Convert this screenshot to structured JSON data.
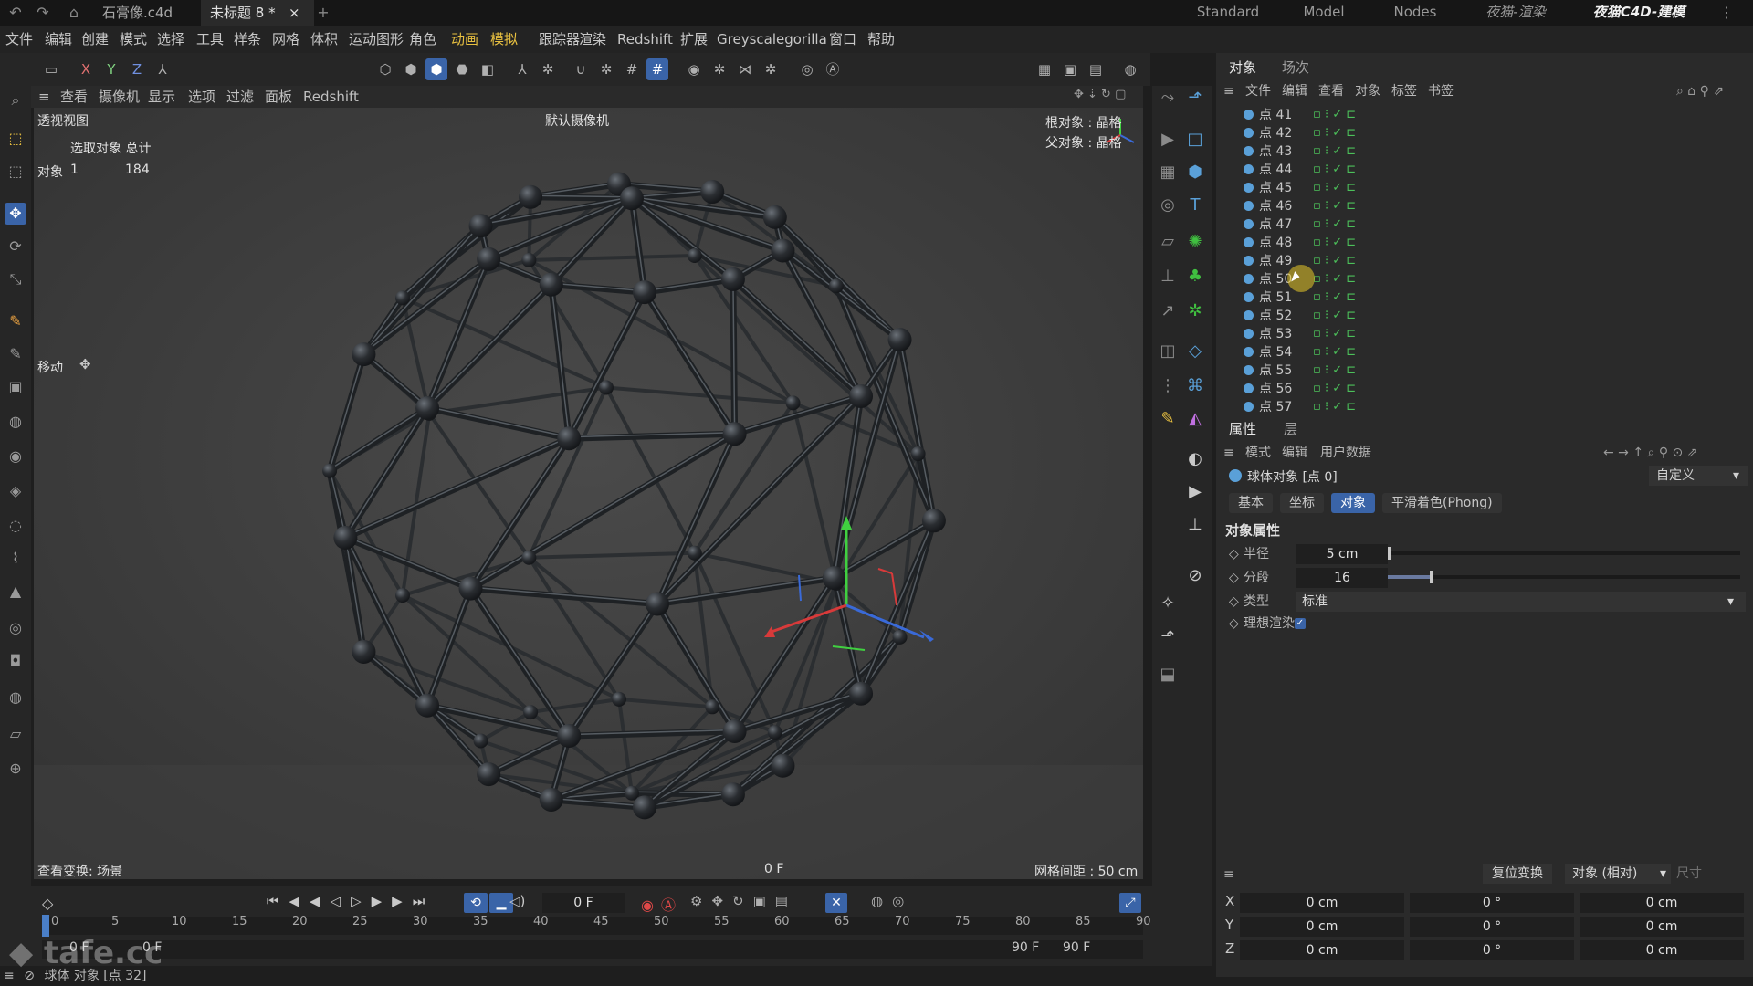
{
  "titlebar": {
    "tabs": [
      {
        "label": "石膏像.c4d",
        "active": false
      },
      {
        "label": "未标题 8 *",
        "active": true
      }
    ],
    "layouts": [
      "Standard",
      "Model",
      "Nodes",
      "夜猫-渲染",
      "夜猫C4D-建模"
    ],
    "active_layout": "夜猫C4D-建模"
  },
  "menubar": {
    "items": [
      "文件",
      "编辑",
      "创建",
      "模式",
      "选择",
      "工具",
      "样条",
      "网格",
      "体积",
      "运动图形",
      "角色",
      "动画",
      "模拟",
      "跟踪器",
      "渲染",
      "Redshift",
      "扩展",
      "Greyscalegorilla",
      "窗口",
      "帮助"
    ],
    "highlighted": [
      "动画",
      "模拟"
    ]
  },
  "viewport": {
    "menu": [
      "查看",
      "摄像机",
      "显示",
      "选项",
      "过滤",
      "面板",
      "Redshift"
    ],
    "view_name": "透视视图",
    "camera": "默认摄像机",
    "selection_header": "选取对象 总计",
    "object_label": "对象",
    "object_selected": "1",
    "object_total": "184",
    "root_object": "根对象 : 晶格",
    "parent_object": "父对象 : 晶格",
    "tool_label": "移动",
    "view_transform": "查看变换: 场景",
    "frame": "0 F",
    "grid_spacing": "网格间距 : 50 cm",
    "axes": [
      "X",
      "Y",
      "Z"
    ]
  },
  "objects_panel": {
    "tabs": [
      "对象",
      "场次"
    ],
    "menu": [
      "文件",
      "编辑",
      "查看",
      "对象",
      "标签",
      "书签"
    ],
    "rows": [
      "点 41",
      "点 42",
      "点 43",
      "点 44",
      "点 45",
      "点 46",
      "点 47",
      "点 48",
      "点 49",
      "点 50",
      "点 51",
      "点 52",
      "点 53",
      "点 54",
      "点 55",
      "点 56",
      "点 57"
    ]
  },
  "attributes_panel": {
    "tabs": [
      "属性",
      "层"
    ],
    "menu": [
      "模式",
      "编辑",
      "用户数据"
    ],
    "object_title": "球体对象 [点 0]",
    "preset": "自定义",
    "subtabs": [
      "基本",
      "坐标",
      "对象",
      "平滑着色(Phong)"
    ],
    "active_subtab": "对象",
    "section": "对象属性",
    "radius_label": "半径",
    "radius_value": "5 cm",
    "segments_label": "分段",
    "segments_value": "16",
    "segments_slider_fraction": 0.12,
    "type_label": "类型",
    "type_value": "标准",
    "render_label": "理想渲染"
  },
  "coordinates": {
    "reset_button": "复位变换",
    "mode": "对象 (相对)",
    "size_label": "尺寸",
    "rows": [
      {
        "axis": "X",
        "pos": "0 cm",
        "rot": "0 °",
        "size": "0 cm"
      },
      {
        "axis": "Y",
        "pos": "0 cm",
        "rot": "0 °",
        "size": "0 cm"
      },
      {
        "axis": "Z",
        "pos": "0 cm",
        "rot": "0 °",
        "size": "0 cm"
      }
    ]
  },
  "timeline": {
    "current_frame": "0 F",
    "ticks": [
      "0",
      "5",
      "10",
      "15",
      "20",
      "25",
      "30",
      "35",
      "40",
      "45",
      "50",
      "55",
      "60",
      "65",
      "70",
      "75",
      "80",
      "85",
      "90"
    ],
    "start": "0 F",
    "start2": "0 F",
    "end": "90 F",
    "end2": "90 F"
  },
  "status": {
    "text": "球体 对象 [点 32]",
    "watermark": "tafe.cc"
  },
  "colors": {
    "accent": "#3a64a8",
    "highlight_menu": "#e8c040",
    "check": "#4cc05a"
  }
}
